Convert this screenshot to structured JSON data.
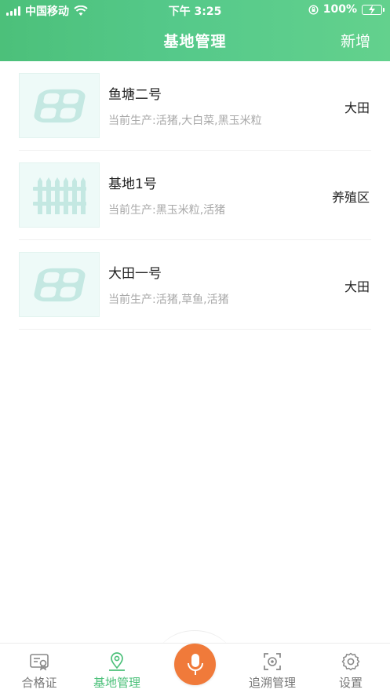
{
  "status_bar": {
    "carrier": "中国移动",
    "time": "下午 3:25",
    "battery": "100%"
  },
  "header": {
    "title": "基地管理",
    "action": "新增"
  },
  "bases": [
    {
      "name": "鱼塘二号",
      "current_label": "当前生产:",
      "products": "活猪,大白菜,黑玉米粒",
      "type": "大田",
      "icon": "field-icon"
    },
    {
      "name": "基地1号",
      "current_label": "当前生产:",
      "products": "黑玉米粒,活猪",
      "type": "养殖区",
      "icon": "fence-icon"
    },
    {
      "name": "大田一号",
      "current_label": "当前生产:",
      "products": "活猪,草鱼,活猪",
      "type": "大田",
      "icon": "field-icon"
    }
  ],
  "tabbar": {
    "tabs": [
      {
        "label": "合格证",
        "icon": "certificate-icon",
        "active": false
      },
      {
        "label": "基地管理",
        "icon": "location-pin-icon",
        "active": true
      },
      {
        "label": "追溯管理",
        "icon": "trace-scan-icon",
        "active": false
      },
      {
        "label": "设置",
        "icon": "gear-icon",
        "active": false
      }
    ],
    "center_button_icon": "microphone-icon"
  },
  "colors": {
    "brand_green": "#4cc07a",
    "mic_orange": "#f07a3a",
    "thumb_bg": "#eefaf8",
    "thumb_icon": "#c4e8e2"
  }
}
